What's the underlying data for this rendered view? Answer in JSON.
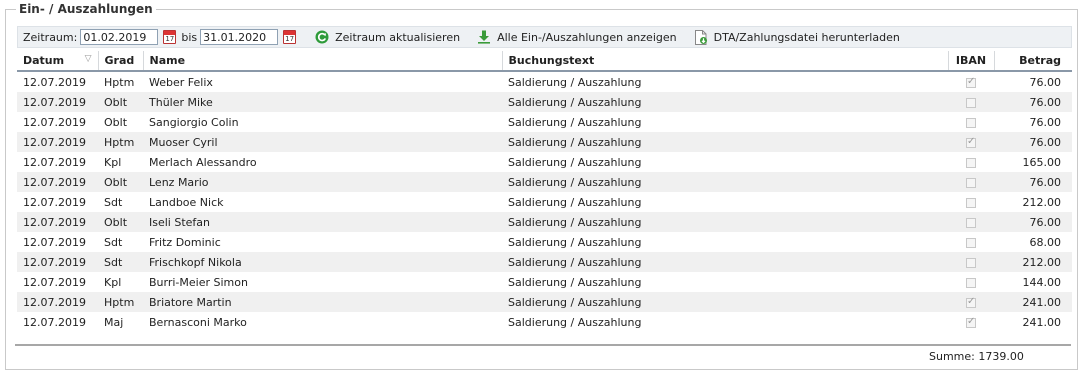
{
  "section": {
    "title": "Ein- / Auszahlungen"
  },
  "toolbar": {
    "from_label": "Zeitraum:",
    "from_value": "01.02.2019",
    "to_label": "bis",
    "to_value": "31.01.2020",
    "calendar_day": "17",
    "refresh_label": "Zeitraum aktualisieren",
    "show_all_label": "Alle Ein-/Auszahlungen anzeigen",
    "download_label": "DTA/Zahlungsdatei herunterladen"
  },
  "columns": {
    "datum": "Datum",
    "grad": "Grad",
    "name": "Name",
    "buchungstext": "Buchungstext",
    "iban": "IBAN",
    "betrag": "Betrag"
  },
  "rows": [
    {
      "datum": "12.07.2019",
      "grad": "Hptm",
      "name": "Weber Felix",
      "text": "Saldierung / Auszahlung",
      "iban": true,
      "betrag": "76.00"
    },
    {
      "datum": "12.07.2019",
      "grad": "Oblt",
      "name": "Thüler Mike",
      "text": "Saldierung / Auszahlung",
      "iban": false,
      "betrag": "76.00"
    },
    {
      "datum": "12.07.2019",
      "grad": "Oblt",
      "name": "Sangiorgio Colin",
      "text": "Saldierung / Auszahlung",
      "iban": false,
      "betrag": "76.00"
    },
    {
      "datum": "12.07.2019",
      "grad": "Hptm",
      "name": "Muoser Cyril",
      "text": "Saldierung / Auszahlung",
      "iban": true,
      "betrag": "76.00"
    },
    {
      "datum": "12.07.2019",
      "grad": "Kpl",
      "name": "Merlach Alessandro",
      "text": "Saldierung / Auszahlung",
      "iban": false,
      "betrag": "165.00"
    },
    {
      "datum": "12.07.2019",
      "grad": "Oblt",
      "name": "Lenz Mario",
      "text": "Saldierung / Auszahlung",
      "iban": false,
      "betrag": "76.00"
    },
    {
      "datum": "12.07.2019",
      "grad": "Sdt",
      "name": "Landboe Nick",
      "text": "Saldierung / Auszahlung",
      "iban": false,
      "betrag": "212.00"
    },
    {
      "datum": "12.07.2019",
      "grad": "Oblt",
      "name": "Iseli Stefan",
      "text": "Saldierung / Auszahlung",
      "iban": false,
      "betrag": "76.00"
    },
    {
      "datum": "12.07.2019",
      "grad": "Sdt",
      "name": "Fritz Dominic",
      "text": "Saldierung / Auszahlung",
      "iban": false,
      "betrag": "68.00"
    },
    {
      "datum": "12.07.2019",
      "grad": "Sdt",
      "name": "Frischkopf Nikola",
      "text": "Saldierung / Auszahlung",
      "iban": false,
      "betrag": "212.00"
    },
    {
      "datum": "12.07.2019",
      "grad": "Kpl",
      "name": "Burri-Meier Simon",
      "text": "Saldierung / Auszahlung",
      "iban": false,
      "betrag": "144.00"
    },
    {
      "datum": "12.07.2019",
      "grad": "Hptm",
      "name": "Briatore Martin",
      "text": "Saldierung / Auszahlung",
      "iban": true,
      "betrag": "241.00"
    },
    {
      "datum": "12.07.2019",
      "grad": "Maj",
      "name": "Bernasconi Marko",
      "text": "Saldierung / Auszahlung",
      "iban": true,
      "betrag": "241.00"
    }
  ],
  "footer": {
    "summe": "Summe: 1739.00"
  },
  "colors": {
    "refresh_icon": "#2e9b3a",
    "download_icon": "#3a9b3a",
    "header_rule": "#8a98a8"
  }
}
